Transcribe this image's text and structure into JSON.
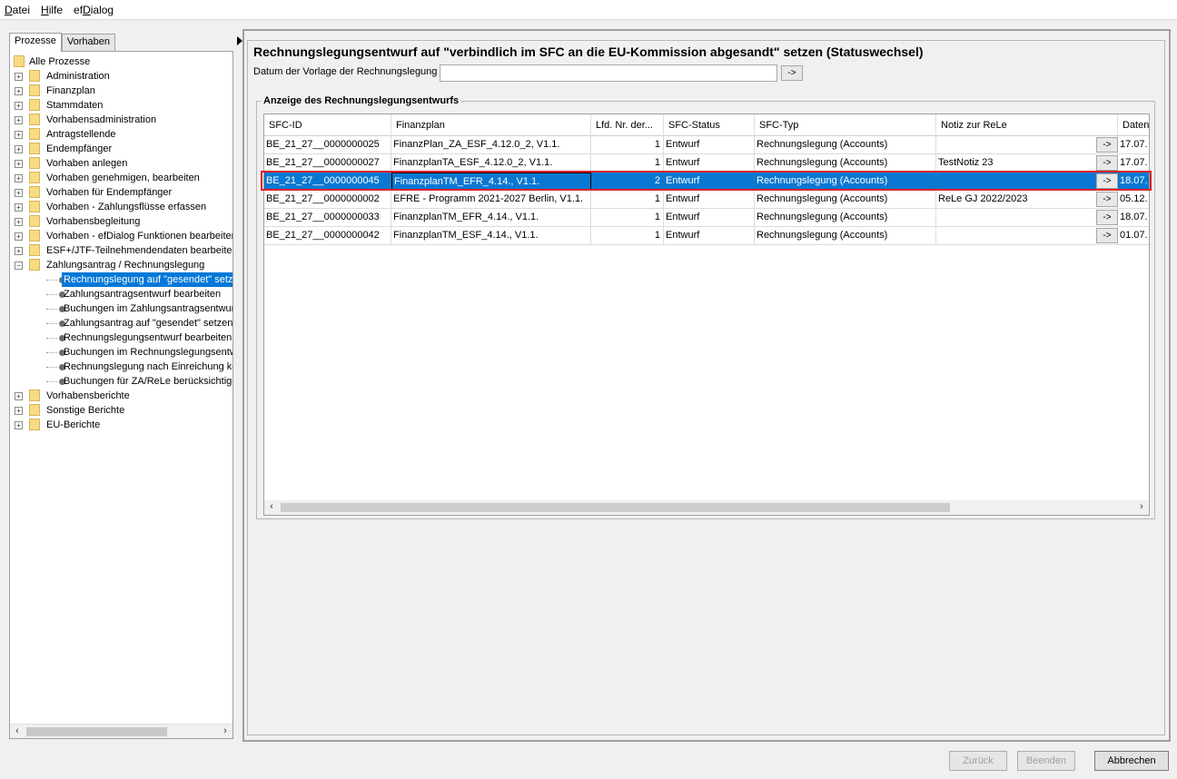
{
  "menu": [
    {
      "pre": "",
      "ul": "D",
      "post": "atei"
    },
    {
      "pre": "",
      "ul": "H",
      "post": "ilfe"
    },
    {
      "pre": "ef",
      "ul": "D",
      "post": "ialog"
    }
  ],
  "left": {
    "tabs": [
      "Prozesse",
      "Vorhaben"
    ],
    "root": "Alle Prozesse",
    "folders": [
      "Administration",
      "Finanzplan",
      "Stammdaten",
      "Vorhabensadministration",
      "Antragstellende",
      "Endempfänger",
      "Vorhaben anlegen",
      "Vorhaben genehmigen, bearbeiten",
      "Vorhaben für Endempfänger",
      "Vorhaben - Zahlungsflüsse erfassen",
      "Vorhabensbegleitung",
      "Vorhaben - efDialog Funktionen bearbeiten",
      "ESF+/JTF-Teilnehmendendaten bearbeiten"
    ],
    "expanded_folder": "Zahlungsantrag / Rechnungslegung",
    "children": [
      "Rechnungslegung auf \"gesendet\" setzen",
      "Zahlungsantragsentwurf bearbeiten",
      "Buchungen im Zahlungsantragsentwurf",
      "Zahlungsantrag auf \"gesendet\" setzen",
      "Rechnungslegungsentwurf bearbeiten",
      "Buchungen im Rechnungslegungsentwurf",
      "Rechnungslegung nach Einreichung korrigieren",
      "Buchungen für ZA/ReLe berücksichtigen"
    ],
    "folders_after": [
      "Vorhabensberichte",
      "Sonstige Berichte",
      "EU-Berichte"
    ]
  },
  "main": {
    "title": "Rechnungslegungsentwurf auf \"verbindlich im SFC an die EU-Kommission abgesandt\" setzen (Statuswechsel)",
    "date_label": "Datum der Vorlage der Rechnungslegung",
    "date_value": "",
    "go_label": "->",
    "group_title": "Anzeige des Rechnungslegungsentwurfs",
    "columns": [
      "SFC-ID",
      "Finanzplan",
      "Lfd. Nr. der...",
      "SFC-Status",
      "SFC-Typ",
      "Notiz zur ReLe",
      "Daten"
    ],
    "rows": [
      [
        "BE_21_27__0000000025",
        "FinanzPlan_ZA_ESF_4.12.0_2, V1.1.",
        "1",
        "Entwurf",
        "Rechnungslegung (Accounts)",
        "",
        "17.07."
      ],
      [
        "BE_21_27__0000000027",
        "FinanzplanTA_ESF_4.12.0_2, V1.1.",
        "1",
        "Entwurf",
        "Rechnungslegung (Accounts)",
        "TestNotiz 23",
        "17.07."
      ],
      [
        "BE_21_27__0000000045",
        "FinanzplanTM_EFR_4.14., V1.1.",
        "2",
        "Entwurf",
        "Rechnungslegung (Accounts)",
        "",
        "18.07."
      ],
      [
        "BE_21_27__0000000002",
        "EFRE - Programm 2021-2027 Berlin, V1.1.",
        "1",
        "Entwurf",
        "Rechnungslegung (Accounts)",
        "ReLe GJ 2022/2023",
        "05.12."
      ],
      [
        "BE_21_27__0000000033",
        "FinanzplanTM_EFR_4.14., V1.1.",
        "1",
        "Entwurf",
        "Rechnungslegung (Accounts)",
        "",
        "18.07."
      ],
      [
        "BE_21_27__0000000042",
        "FinanzplanTM_ESF_4.14., V1.1.",
        "1",
        "Entwurf",
        "Rechnungslegung (Accounts)",
        "",
        "01.07."
      ]
    ],
    "selected_row": 2
  },
  "buttons": {
    "back": "Zurück",
    "finish": "Beenden",
    "cancel": "Abbrechen"
  },
  "colors": {
    "selection": "#0a78d2",
    "highlight_outline": "#e0202a",
    "folder": "#f7dc84"
  }
}
